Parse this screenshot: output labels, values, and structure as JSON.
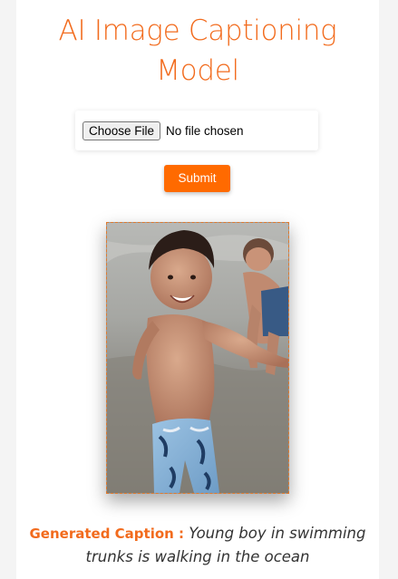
{
  "page": {
    "title": "AI Image Captioning Model"
  },
  "upload": {
    "button_label": "Choose File",
    "status_text": "No file chosen"
  },
  "form": {
    "submit_label": "Submit"
  },
  "result": {
    "image_description": "Photo of a smiling young boy in blue patterned swimming trunks at the beach, another child in the background",
    "caption_label": "Generated Caption :",
    "caption_text": "Young boy in swimming trunks is walking in the ocean"
  },
  "colors": {
    "accent": "#f26b1d",
    "button": "#ff6a00"
  }
}
